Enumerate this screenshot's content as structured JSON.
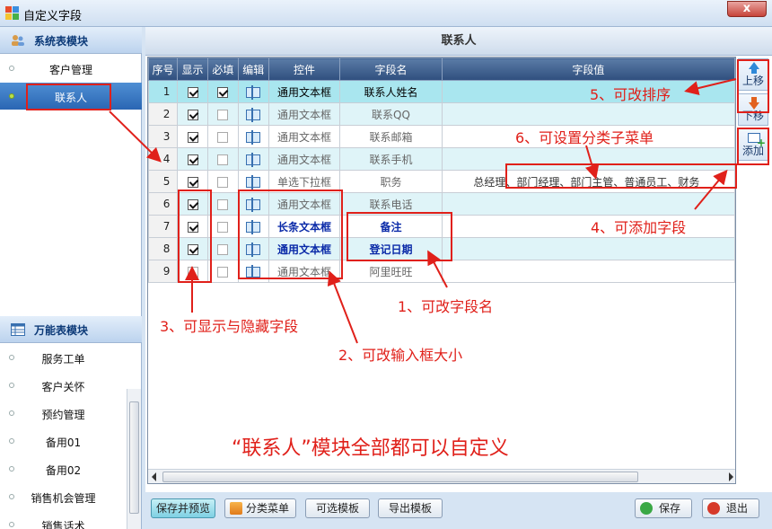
{
  "window": {
    "title": "自定义字段",
    "close_symbol": "x"
  },
  "sidebar": {
    "system_group": {
      "title": "系统表模块",
      "items": [
        {
          "label": "客户管理",
          "active": false
        },
        {
          "label": "联系人",
          "active": true
        }
      ]
    },
    "universal_group": {
      "title": "万能表模块",
      "items": [
        {
          "label": "服务工单"
        },
        {
          "label": "客户关怀"
        },
        {
          "label": "预约管理"
        },
        {
          "label": "备用01"
        },
        {
          "label": "备用02"
        },
        {
          "label": "销售机会管理"
        },
        {
          "label": "销售话术"
        }
      ]
    }
  },
  "panel": {
    "title": "联系人"
  },
  "grid": {
    "headers": {
      "seq": "序号",
      "show": "显示",
      "required": "必填",
      "edit": "编辑",
      "control": "控件",
      "field_name": "字段名",
      "field_value": "字段值"
    },
    "rows": [
      {
        "seq": "1",
        "show": true,
        "required": true,
        "control": "通用文本框",
        "field_name": "联系人姓名",
        "value": ""
      },
      {
        "seq": "2",
        "show": true,
        "required": false,
        "control": "通用文本框",
        "field_name": "联系QQ",
        "value": ""
      },
      {
        "seq": "3",
        "show": true,
        "required": false,
        "control": "通用文本框",
        "field_name": "联系邮箱",
        "value": ""
      },
      {
        "seq": "4",
        "show": true,
        "required": false,
        "control": "通用文本框",
        "field_name": "联系手机",
        "value": ""
      },
      {
        "seq": "5",
        "show": true,
        "required": false,
        "control": "单选下拉框",
        "field_name": "职务",
        "value": "总经理、部门经理、部门主管、普通员工、财务"
      },
      {
        "seq": "6",
        "show": true,
        "required": false,
        "control": "通用文本框",
        "field_name": "联系电话",
        "value": ""
      },
      {
        "seq": "7",
        "show": true,
        "required": false,
        "control": "长条文本框",
        "field_name": "备注",
        "value": ""
      },
      {
        "seq": "8",
        "show": true,
        "required": false,
        "control": "通用文本框",
        "field_name": "登记日期",
        "value": ""
      },
      {
        "seq": "9",
        "show": false,
        "required": false,
        "control": "通用文本框",
        "field_name": "阿里旺旺",
        "value": ""
      }
    ]
  },
  "side_buttons": {
    "move_up": "上移",
    "move_down": "下移",
    "add": "添加"
  },
  "bottom_buttons": {
    "save_preview": "保存并预览",
    "category_menu": "分类菜单",
    "optional_template": "可选模板",
    "export_template": "导出模板",
    "save": "保存",
    "exit": "退出"
  },
  "annotations": {
    "a1": "1、可改字段名",
    "a2": "2、可改输入框大小",
    "a3": "3、可显示与隐藏字段",
    "a4": "4、可添加字段",
    "a5": "5、可改排序",
    "a6": "6、可设置分类子菜单",
    "banner": "“联系人”模块全部都可以自定义"
  },
  "colors": {
    "annotation": "#e0201a",
    "header_bg": "#2f4f7e",
    "selected_row": "#a9e6ef",
    "alt_row": "#dff4f8"
  }
}
